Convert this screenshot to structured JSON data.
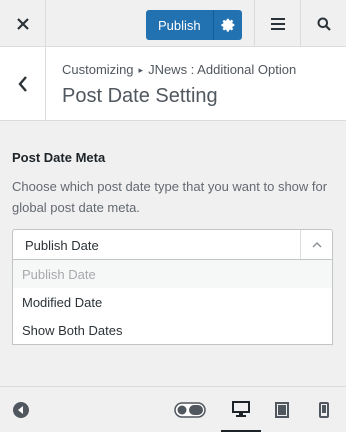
{
  "header": {
    "close_icon": "close-icon",
    "publish_label": "Publish",
    "publish_settings_icon": "gear-icon",
    "menu_icon": "hamburger-icon",
    "search_icon": "search-icon"
  },
  "section": {
    "back_icon": "chevron-left-icon",
    "breadcrumb_root": "Customizing",
    "breadcrumb_separator": "▸",
    "breadcrumb_parent": "JNews : Additional Option",
    "title": "Post Date Setting"
  },
  "control": {
    "title": "Post Date Meta",
    "description": "Choose which post date type that you want to show for global post date meta.",
    "selected_value": "Publish Date",
    "options": [
      "Publish Date",
      "Modified Date",
      "Show Both Dates"
    ]
  },
  "footer": {
    "collapse_icon": "collapse-icon",
    "toggle_icon": "toggle-icon",
    "devices": [
      "desktop",
      "tablet",
      "mobile"
    ],
    "active_device": "desktop"
  },
  "colors": {
    "accent": "#2271b1",
    "background": "#f0f0f1",
    "text": "#2c3338"
  }
}
